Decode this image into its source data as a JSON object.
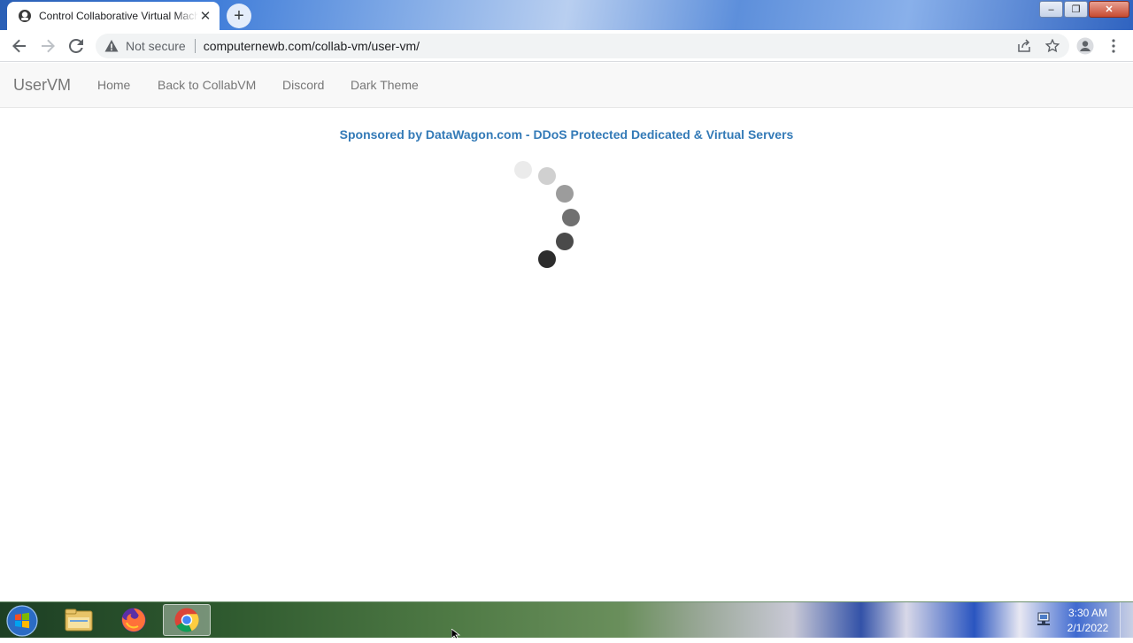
{
  "browser": {
    "tab": {
      "title": "Control Collaborative Virtual Machines",
      "favicon": "collabvm-icon"
    },
    "new_tab": "+",
    "window_controls": {
      "minimize": "‒",
      "maximize": "❐",
      "close": "✕"
    }
  },
  "toolbar": {
    "security_label": "Not secure",
    "url": "computernewb.com/collab-vm/user-vm/"
  },
  "site_nav": {
    "brand": "UserVM",
    "links": [
      "Home",
      "Back to CollabVM",
      "Discord",
      "Dark Theme"
    ]
  },
  "content": {
    "sponsor_text": "Sponsored by DataWagon.com - DDoS Protected Dedicated & Virtual Servers",
    "loading_spinner": {
      "dot_colors": [
        "#ebebeb",
        "#d0d0d0",
        "#9c9c9c",
        "#707070",
        "#4a4a4a",
        "#2c2c2c"
      ]
    }
  },
  "taskbar": {
    "apps": [
      "file-explorer-icon",
      "firefox-icon",
      "chrome-icon"
    ],
    "active_app": "chrome-icon",
    "clock": {
      "time": "3:30 AM",
      "date": "2/1/2022"
    }
  },
  "colors": {
    "link": "#337ab7",
    "nav_text": "#777777"
  }
}
